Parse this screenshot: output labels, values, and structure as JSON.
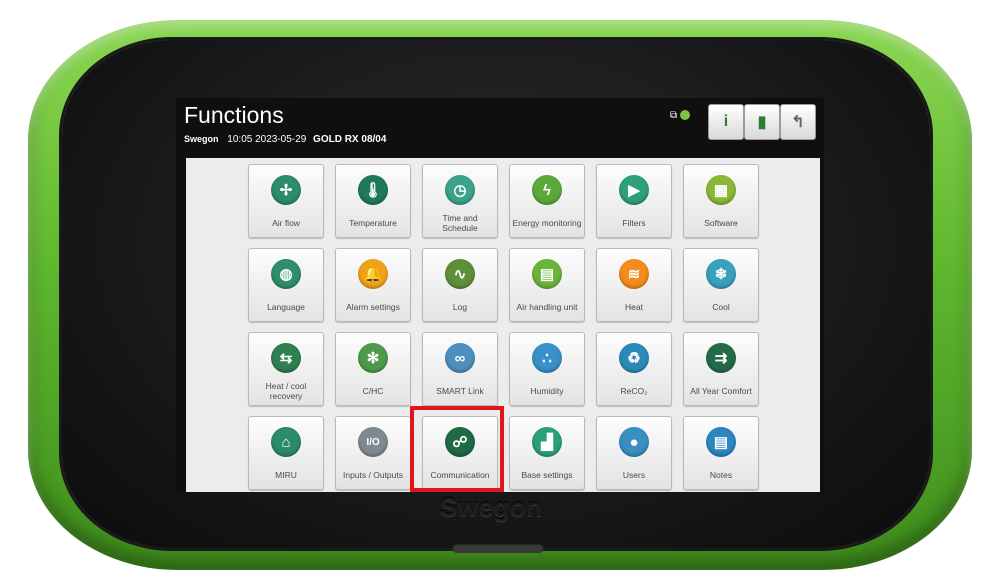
{
  "header": {
    "title": "Functions",
    "brand": "Swegon",
    "time": "10:05",
    "date": "2023-05-29",
    "unit": "GOLD RX 08/04"
  },
  "toolbar": {
    "info_icon": "info-icon",
    "door_icon": "door-icon",
    "back_icon": "back-arrow-icon"
  },
  "device": {
    "brand_logo": "Swegon",
    "bezel_color": "#5fb72f"
  },
  "tiles": [
    {
      "label": "Air flow",
      "icon": "fan-icon",
      "color": "#2e8b6e"
    },
    {
      "label": "Temperature",
      "icon": "thermometer-icon",
      "color": "#1f7a5a"
    },
    {
      "label": "Time and Schedule",
      "icon": "clock-icon",
      "color": "#3aa38a"
    },
    {
      "label": "Energy monitoring",
      "icon": "energy-icon",
      "color": "#5ca83b"
    },
    {
      "label": "Filters",
      "icon": "filter-icon",
      "color": "#2ea07a"
    },
    {
      "label": "Software",
      "icon": "chip-icon",
      "color": "#8ab836"
    },
    {
      "label": "Language",
      "icon": "globe-icon",
      "color": "#2f8f6a"
    },
    {
      "label": "Alarm settings",
      "icon": "bell-icon",
      "color": "#f0a21a"
    },
    {
      "label": "Log",
      "icon": "chart-icon",
      "color": "#5f8f3a"
    },
    {
      "label": "Air handling unit",
      "icon": "ahu-icon",
      "color": "#6ab43a"
    },
    {
      "label": "Heat",
      "icon": "heat-icon",
      "color": "#f28c1a"
    },
    {
      "label": "Cool",
      "icon": "snowflake-icon",
      "color": "#3aa0c0"
    },
    {
      "label": "Heat / cool recovery",
      "icon": "recovery-icon",
      "color": "#2f8050"
    },
    {
      "label": "C/HC",
      "icon": "chc-icon",
      "color": "#4e9a4a"
    },
    {
      "label": "SMART Link",
      "icon": "link-icon",
      "color": "#4e8fc0"
    },
    {
      "label": "Humidity",
      "icon": "drops-icon",
      "color": "#3a90c8"
    },
    {
      "label": "ReCO₂",
      "icon": "reco2-icon",
      "color": "#2c8ab8"
    },
    {
      "label": "All Year Comfort",
      "icon": "arrows-icon",
      "color": "#236b48"
    },
    {
      "label": "MIRU",
      "icon": "house-icon",
      "color": "#2a8a6a"
    },
    {
      "label": "Inputs / Outputs",
      "icon": "io-icon",
      "color": "#7f8a90"
    },
    {
      "label": "Communication",
      "icon": "network-icon",
      "color": "#1e6b45"
    },
    {
      "label": "Base settings",
      "icon": "factory-icon",
      "color": "#2aa07a"
    },
    {
      "label": "Users",
      "icon": "user-icon",
      "color": "#3a8fc0"
    },
    {
      "label": "Notes",
      "icon": "notepad-icon",
      "color": "#2d86c0"
    }
  ],
  "highlight_color": "#e0161b"
}
